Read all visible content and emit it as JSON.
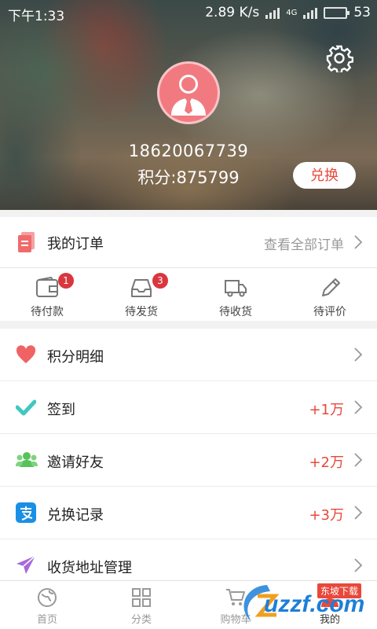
{
  "statusbar": {
    "time": "下午1:33",
    "speed": "2.89 K/s",
    "network": "4G",
    "battery": "53"
  },
  "profile": {
    "phone": "18620067739",
    "points_label": "积分:875799",
    "exchange_label": "兑换"
  },
  "orders": {
    "title": "我的订单",
    "view_all": "查看全部订单",
    "statuses": [
      {
        "label": "待付款",
        "badge": "1",
        "icon": "wallet-icon"
      },
      {
        "label": "待发货",
        "badge": "3",
        "icon": "inbox-tray-icon"
      },
      {
        "label": "待收货",
        "badge": "",
        "icon": "truck-icon"
      },
      {
        "label": "待评价",
        "badge": "",
        "icon": "pencil-icon"
      }
    ]
  },
  "menu": [
    {
      "label": "积分明细",
      "value": "",
      "icon": "heart-icon",
      "color": "#f06263"
    },
    {
      "label": "签到",
      "value": "+1万",
      "icon": "checkmark-icon",
      "color": "#40c8c0"
    },
    {
      "label": "邀请好友",
      "value": "+2万",
      "icon": "friends-icon",
      "color": "#58c25a"
    },
    {
      "label": "兑换记录",
      "value": "+3万",
      "icon": "alipay-icon",
      "color": "#1a8fe6"
    },
    {
      "label": "收货地址管理",
      "value": "",
      "icon": "paper-plane-icon",
      "color": "#a66ad9"
    }
  ],
  "bottom_nav": [
    {
      "label": "首页",
      "icon": "globe-icon"
    },
    {
      "label": "分类",
      "icon": "grid-icon"
    },
    {
      "label": "购物车",
      "icon": "cart-icon"
    },
    {
      "label": "我的",
      "icon": "profile-icon",
      "active": true
    }
  ],
  "watermark": {
    "text": "uzzf.com",
    "tag": "东坡下载"
  },
  "colors": {
    "accent": "#e8483b",
    "badge": "#d9363e"
  }
}
